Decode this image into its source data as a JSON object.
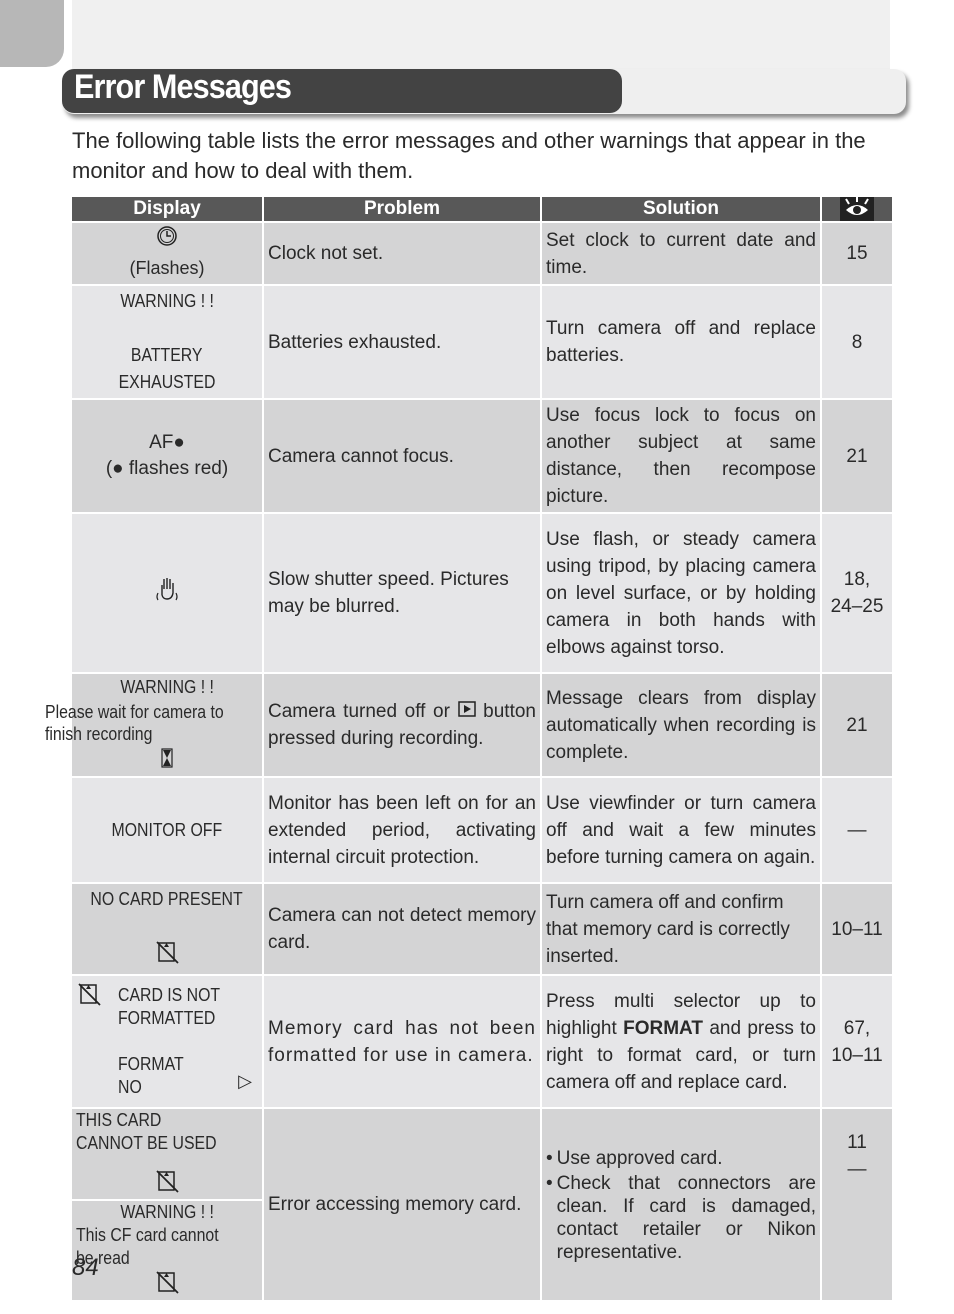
{
  "page": {
    "title": "Error Messages",
    "intro": "The following table lists the error messages and other warnings that appear in the monitor and how to deal with them.",
    "page_number": "84"
  },
  "table": {
    "headers": {
      "display": "Display",
      "problem": "Problem",
      "solution": "Solution",
      "page_icon": "eye-icon"
    },
    "rows": [
      {
        "display_icon": "clock-icon",
        "display_text": "(Flashes)",
        "problem": "Clock not set.",
        "solution": "Set clock to current date and time.",
        "page": "15"
      },
      {
        "display_line1": "WARNING ! !",
        "display_line2": "BATTERY",
        "display_line3": "EXHAUSTED",
        "problem": "Batteries exhausted.",
        "solution": "Turn camera off and replace batteries.",
        "page": "8"
      },
      {
        "display_line1": "AF●",
        "display_line2": "(● flashes red)",
        "problem": "Camera cannot focus.",
        "solution": "Use focus lock to focus on another subject at same distance, then recompose picture.",
        "page": "21"
      },
      {
        "display_icon": "shaking-hand-icon",
        "problem": "Slow shutter speed.  Pictures may be blurred.",
        "solution": "Use flash, or steady camera using tripod, by placing camera on level surface, or by holding camera in both hands with elbows against torso.",
        "page": "18, 24–25"
      },
      {
        "display_line1": "WARNING ! !",
        "display_line2": "Please wait for camera to finish recording",
        "display_icon": "hourglass-icon",
        "problem_before": "Camera turned off or",
        "problem_icon": "playback-button-icon",
        "problem_after": "button pressed during recording.",
        "solution": "Message clears from display automatically when recording is complete.",
        "page": "21"
      },
      {
        "display_line1": "MONITOR OFF",
        "problem": "Monitor has been left on for an extended period, activating internal circuit protection.",
        "solution": "Use viewfinder or turn camera off and wait a few minutes before turning camera on again.",
        "page": "—"
      },
      {
        "display_line1": "NO CARD PRESENT",
        "display_icon": "no-card-icon",
        "problem": "Camera can not detect memory card.",
        "solution": "Turn camera off and confirm that memory card is correctly inserted.",
        "page": "10–11"
      },
      {
        "display_icon": "no-card-icon",
        "display_line1": "CARD IS NOT",
        "display_line2": "FORMATTED",
        "display_line3": "FORMAT",
        "display_line4": "NO",
        "display_arrow": "▷",
        "problem": "Memory card has not been formatted for use in camera.",
        "solution_before": "Press multi selector up to highlight",
        "solution_bold": "FORMAT",
        "solution_after": "and press to right to format card, or turn camera off and replace card.",
        "page": "67, 10–11"
      },
      {
        "display_a_line1": "THIS CARD",
        "display_a_line2": "CANNOT BE USED",
        "display_b_line1": "WARNING ! !",
        "display_b_line2": "This CF card cannot",
        "display_b_line3": "be read",
        "problem": "Error accessing memory card.",
        "solution_bullets": [
          "Use approved card.",
          "Check that connectors are clean.  If card is damaged, contact retailer or Nikon representative."
        ],
        "page_a": "11",
        "page_b": "—"
      }
    ]
  }
}
